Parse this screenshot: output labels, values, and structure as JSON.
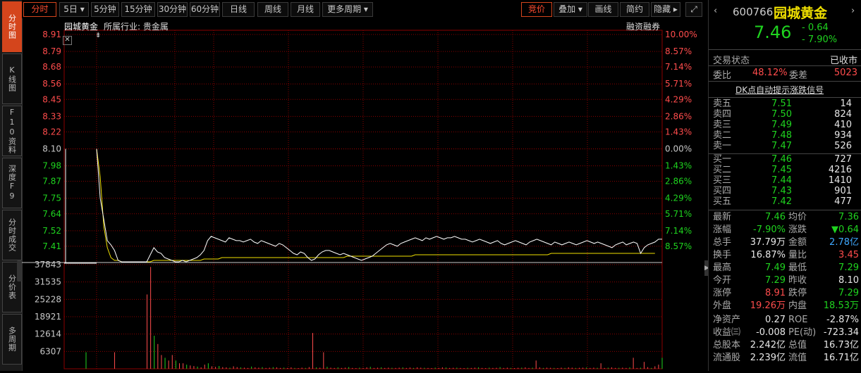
{
  "sidebar": {
    "tabs": [
      {
        "label": "分时图",
        "active": true
      },
      {
        "label": "K线图",
        "active": false
      },
      {
        "label": "F10资料",
        "active": false
      },
      {
        "label": "深度F9",
        "active": false
      },
      {
        "label": "分时成交",
        "active": false
      },
      {
        "label": "分价表",
        "active": false
      },
      {
        "label": "多周期",
        "active": false
      }
    ]
  },
  "toolbar": {
    "left": [
      {
        "label": "分时",
        "active": true
      },
      {
        "label": "5日 ▾",
        "active": false
      },
      {
        "label": "5分钟",
        "active": false
      },
      {
        "label": "15分钟",
        "active": false
      },
      {
        "label": "30分钟",
        "active": false
      },
      {
        "label": "60分钟",
        "active": false
      },
      {
        "label": "日线",
        "active": false
      },
      {
        "label": "周线",
        "active": false
      },
      {
        "label": "月线",
        "active": false
      },
      {
        "label": "更多周期 ▾",
        "active": false
      }
    ],
    "right": [
      {
        "label": "竞价",
        "active": true
      },
      {
        "label": "叠加 ▾",
        "active": false
      },
      {
        "label": "画线",
        "active": false
      },
      {
        "label": "简约",
        "active": false
      },
      {
        "label": "隐藏 ▸",
        "active": false
      }
    ],
    "fullscreen_icon": "expand-icon"
  },
  "chart_info": {
    "name": "园城黄金",
    "industry": "所属行业: 贵金属",
    "tag": "融资融券",
    "close_icon": "close-icon"
  },
  "chart_data": {
    "type": "line",
    "price_ticks": [
      "8.91",
      "8.79",
      "8.68",
      "8.56",
      "8.45",
      "8.33",
      "8.22",
      "8.10",
      "7.98",
      "7.87",
      "7.75",
      "7.64",
      "7.52",
      "7.41"
    ],
    "pct_ticks": [
      "10.00%",
      "8.57%",
      "7.14%",
      "5.71%",
      "4.29%",
      "2.86%",
      "1.43%",
      "0.00%",
      "1.43%",
      "2.86%",
      "4.29%",
      "5.71%",
      "7.14%",
      "8.57%"
    ],
    "ylim": [
      7.29,
      8.91
    ],
    "prev_close": 8.1,
    "volume_ticks": [
      "37843",
      "31535",
      "25228",
      "18921",
      "12614",
      "6307"
    ],
    "volume_max": 37843,
    "series": [
      {
        "values": [
          8.1,
          7.75,
          7.6,
          7.45,
          7.42,
          7.38,
          7.31,
          7.3,
          7.3,
          7.3,
          7.3,
          7.3,
          7.3,
          7.3,
          7.3,
          7.35,
          7.4,
          7.37,
          7.36,
          7.33,
          7.32,
          7.31,
          7.3,
          7.3,
          7.31,
          7.3,
          7.31,
          7.32,
          7.33,
          7.35,
          7.38,
          7.45,
          7.48,
          7.47,
          7.46,
          7.45,
          7.44,
          7.47,
          7.46,
          7.45,
          7.45,
          7.44,
          7.45,
          7.46,
          7.44,
          7.43,
          7.45,
          7.44,
          7.43,
          7.42,
          7.41,
          7.43,
          7.42,
          7.4,
          7.38,
          7.36,
          7.35,
          7.37,
          7.36,
          7.33,
          7.31,
          7.32,
          7.35,
          7.37,
          7.38,
          7.38,
          7.37,
          7.36,
          7.35,
          7.36,
          7.35,
          7.34,
          7.33,
          7.32,
          7.31,
          7.32,
          7.33,
          7.34,
          7.36,
          7.38,
          7.4,
          7.42,
          7.43,
          7.42,
          7.41,
          7.43,
          7.44,
          7.45,
          7.46,
          7.47,
          7.46,
          7.45,
          7.47,
          7.46,
          7.47,
          7.48,
          7.47,
          7.46,
          7.47,
          7.47,
          7.48,
          7.47,
          7.46,
          7.46,
          7.45,
          7.44,
          7.45,
          7.46,
          7.45,
          7.44,
          7.43,
          7.44,
          7.45,
          7.43,
          7.42,
          7.43,
          7.44,
          7.45,
          7.44,
          7.43,
          7.42,
          7.44,
          7.45,
          7.46,
          7.45,
          7.44,
          7.43,
          7.42,
          7.44,
          7.43,
          7.42,
          7.43,
          7.44,
          7.43,
          7.42,
          7.43,
          7.44,
          7.45,
          7.44,
          7.43,
          7.44,
          7.43,
          7.42,
          7.41,
          7.4,
          7.42,
          7.43,
          7.44,
          7.42,
          7.43,
          7.44,
          7.43,
          7.36,
          7.4,
          7.42,
          7.43,
          7.44,
          7.46,
          7.46
        ]
      },
      {
        "values": [
          8.1,
          7.9,
          7.55,
          7.4,
          7.33,
          7.31,
          7.31,
          7.3,
          7.3,
          7.3,
          7.3,
          7.3,
          7.3,
          7.3,
          7.3,
          7.3,
          7.31,
          7.31,
          7.31,
          7.31,
          7.31,
          7.31,
          7.31,
          7.31,
          7.31,
          7.31,
          7.31,
          7.31,
          7.31,
          7.31,
          7.32,
          7.32,
          7.32,
          7.32,
          7.32,
          7.33,
          7.33,
          7.33,
          7.33,
          7.33,
          7.33,
          7.33,
          7.33,
          7.33,
          7.33,
          7.33,
          7.33,
          7.33,
          7.33,
          7.33,
          7.33,
          7.33,
          7.33,
          7.33,
          7.33,
          7.33,
          7.33,
          7.33,
          7.33,
          7.33,
          7.33,
          7.33,
          7.33,
          7.33,
          7.33,
          7.33,
          7.33,
          7.33,
          7.33,
          7.33,
          7.34,
          7.34,
          7.34,
          7.34,
          7.34,
          7.34,
          7.34,
          7.34,
          7.34,
          7.34,
          7.34,
          7.34,
          7.34,
          7.34,
          7.34,
          7.34,
          7.34,
          7.34,
          7.34,
          7.35,
          7.35,
          7.35,
          7.35,
          7.35,
          7.35,
          7.35,
          7.35,
          7.35,
          7.35,
          7.35,
          7.35,
          7.35,
          7.35,
          7.35,
          7.35,
          7.35,
          7.35,
          7.35,
          7.35,
          7.35,
          7.35,
          7.35,
          7.35,
          7.35,
          7.35,
          7.35,
          7.35,
          7.35,
          7.35,
          7.35,
          7.35,
          7.35,
          7.35,
          7.35,
          7.35,
          7.35,
          7.35,
          7.36,
          7.36,
          7.36,
          7.36,
          7.36,
          7.36,
          7.36,
          7.36,
          7.36,
          7.36,
          7.36,
          7.36,
          7.36,
          7.36,
          7.36,
          7.36,
          7.36,
          7.36,
          7.36,
          7.36,
          7.36,
          7.36,
          7.36,
          7.36,
          7.36,
          7.36,
          7.36,
          7.36,
          7.36,
          7.36
        ]
      }
    ],
    "volume": [
      0,
      0,
      0,
      0,
      0,
      6000,
      0,
      0,
      0,
      0,
      0,
      0,
      0,
      0,
      27000,
      37000,
      12000,
      9000,
      5000,
      4000,
      3000,
      5000,
      3000,
      2000,
      2000,
      1500,
      1200,
      1000,
      800,
      500,
      1500,
      2000,
      900,
      700,
      1000,
      600,
      500,
      400,
      900,
      600,
      500,
      400,
      300,
      800,
      500,
      400,
      600,
      300,
      400,
      600,
      500,
      300,
      400,
      300,
      500,
      300,
      250,
      400,
      300,
      600,
      13000,
      500,
      400,
      6000,
      700,
      400,
      300,
      500,
      300,
      400,
      600,
      300,
      250,
      400,
      300,
      500,
      700,
      300,
      400,
      500,
      300,
      400,
      350,
      300,
      400,
      500,
      300,
      450,
      300,
      500,
      400,
      350,
      300,
      250,
      400,
      300,
      500,
      450,
      300,
      350,
      400,
      300,
      250,
      350,
      300,
      400,
      500,
      300,
      250,
      400,
      300,
      350,
      600,
      300,
      400,
      300,
      250,
      350,
      400,
      500,
      300,
      400,
      3000,
      500,
      300,
      400,
      350,
      300,
      250,
      400,
      300,
      500,
      400,
      300,
      350,
      400,
      450,
      300,
      400,
      350,
      2000,
      300,
      400,
      500,
      300,
      350,
      400,
      300,
      500,
      4000,
      300,
      400,
      2500,
      600,
      300,
      900,
      1500,
      4000
    ]
  },
  "quote": {
    "code": "600766",
    "name": "园城黄金",
    "price": "7.46",
    "change": "- 0.64",
    "change_pct": "- 7.90%",
    "trade_status_label": "交易状态",
    "trade_status": "已收市",
    "wb_label": "委比",
    "wb": "48.12%",
    "wc_label": "委差",
    "wc": "5023",
    "signal_link": "DK点自动提示涨跌信号",
    "asks": [
      {
        "label": "卖五",
        "price": "7.51",
        "vol": "14"
      },
      {
        "label": "卖四",
        "price": "7.50",
        "vol": "824"
      },
      {
        "label": "卖三",
        "price": "7.49",
        "vol": "410"
      },
      {
        "label": "卖二",
        "price": "7.48",
        "vol": "934"
      },
      {
        "label": "卖一",
        "price": "7.47",
        "vol": "526"
      }
    ],
    "bids": [
      {
        "label": "买一",
        "price": "7.46",
        "vol": "727"
      },
      {
        "label": "买二",
        "price": "7.45",
        "vol": "4216"
      },
      {
        "label": "买三",
        "price": "7.44",
        "vol": "1410"
      },
      {
        "label": "买四",
        "price": "7.43",
        "vol": "901"
      },
      {
        "label": "买五",
        "price": "7.42",
        "vol": "477"
      }
    ],
    "stats": [
      {
        "l1": "最新",
        "v1": "7.46",
        "c1": "green",
        "l2": "均价",
        "v2": "7.36",
        "c2": "green"
      },
      {
        "l1": "涨幅",
        "v1": "-7.90%",
        "c1": "green",
        "l2": "涨跌",
        "v2": "▼0.64",
        "c2": "green"
      },
      {
        "l1": "总手",
        "v1": "37.79万",
        "c1": "white",
        "l2": "金额",
        "v2": "2.78亿",
        "c2": "blue"
      },
      {
        "l1": "换手",
        "v1": "16.87%",
        "c1": "white",
        "l2": "量比",
        "v2": "3.45",
        "c2": "red"
      },
      {
        "l1": "最高",
        "v1": "7.49",
        "c1": "green",
        "l2": "最低",
        "v2": "7.29",
        "c2": "green"
      },
      {
        "l1": "今开",
        "v1": "7.29",
        "c1": "green",
        "l2": "昨收",
        "v2": "8.10",
        "c2": "white"
      },
      {
        "l1": "涨停",
        "v1": "8.91",
        "c1": "red",
        "l2": "跌停",
        "v2": "7.29",
        "c2": "green"
      },
      {
        "l1": "外盘",
        "v1": "19.26万",
        "c1": "red",
        "l2": "内盘",
        "v2": "18.53万",
        "c2": "green"
      },
      {
        "l1": "净资产",
        "v1": "0.27",
        "c1": "white",
        "l2": "ROE",
        "v2": "-2.87%",
        "c2": "white"
      },
      {
        "l1": "收益㈢",
        "v1": "-0.008",
        "c1": "white",
        "l2": "PE(动)",
        "v2": "-723.34",
        "c2": "white"
      },
      {
        "l1": "总股本",
        "v1": "2.242亿",
        "c1": "white",
        "l2": "总值",
        "v2": "16.73亿",
        "c2": "white"
      },
      {
        "l1": "流通股",
        "v1": "2.239亿",
        "c1": "white",
        "l2": "流值",
        "v2": "16.71亿",
        "c2": "white"
      }
    ]
  },
  "colors": {
    "accent": "#d4451c",
    "up": "#ff4c4c",
    "down": "#1fd41f",
    "price_line": "#ffffff",
    "avg_line": "#f0e000",
    "grid": "#8b0000"
  }
}
